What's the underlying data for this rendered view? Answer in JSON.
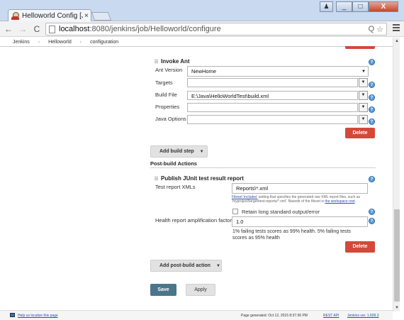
{
  "browser": {
    "tab_title": "Helloworld Config [Je",
    "tab_close": "×",
    "url_host": "localhost",
    "url_path": ":8080/jenkins/job/Helloworld/configure",
    "back": "←",
    "forward": "→",
    "reload": "C",
    "minimize": "_",
    "maximize": "□",
    "close": "X",
    "omni_search": "Q",
    "omni_star": "☆"
  },
  "breadcrumb": [
    "Jenkins",
    "Helloworld",
    "configuration"
  ],
  "breadcrumb_sep": "›",
  "invoke_ant": {
    "title": "Invoke Ant",
    "ant_version_label": "Ant Version",
    "ant_version_value": "NewHome",
    "targets_label": "Targets",
    "targets_value": "",
    "build_file_label": "Build File",
    "build_file_value": "E:\\Java\\HelloWorldTest\\build.xml",
    "properties_label": "Properties",
    "properties_value": "",
    "java_options_label": "Java Options",
    "java_options_value": "",
    "delete_label": "Delete"
  },
  "add_build_step_label": "Add build step",
  "post_build_title": "Post-build Actions",
  "junit": {
    "title": "Publish JUnit test result report",
    "xmls_label": "Test report XMLs",
    "xmls_value": "Reports\\*.xml",
    "hint_link": "Fileset 'includes'",
    "hint_rest": " setting that specifies the generated raw XML report files, such as 'myproject/target/test-reports/*.xml'. Basedir of the fileset is ",
    "hint_link2": "the workspace root",
    "hint_end": ".",
    "retain_label": "Retain long standard output/error",
    "health_label": "Health report amplification factor",
    "health_value": "1.0",
    "health_desc_1": "1% failing tests scores as 99% health. 5% failing tests",
    "health_desc_2": "scores as 95% health",
    "delete_label": "Delete"
  },
  "add_post_build_label": "Add post-build action",
  "save_label": "Save",
  "apply_label": "Apply",
  "footer": {
    "localize": "Help us localize this page",
    "generated": "Page generated: Oct 12, 2015 8:37:36 PM",
    "rest_api": "REST API",
    "version": "Jenkins ver. 1.609.3"
  },
  "help_glyph": "?",
  "dropdown_glyph": "▼",
  "caret_glyph": "▼",
  "colors": {
    "delete_red": "#d24939",
    "save_blue": "#4b758b",
    "help_blue": "#5a9bd5",
    "chrome_blue": "#c9daf0"
  }
}
